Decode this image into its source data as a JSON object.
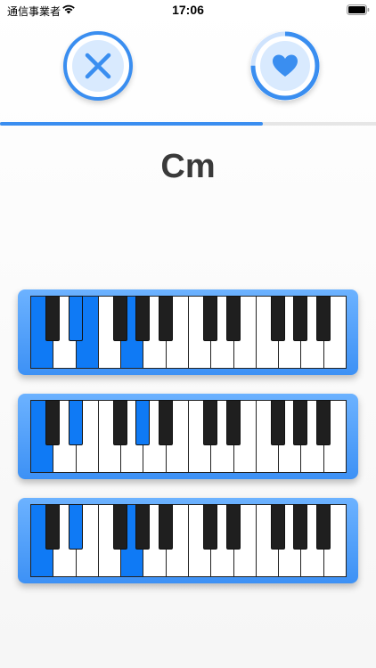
{
  "status": {
    "carrier": "通信事業者",
    "time": "17:06",
    "battery_icon": "battery-icon",
    "wifi_icon": "wifi-icon"
  },
  "controls": {
    "close_icon": "close-icon",
    "favorite_icon": "heart-icon",
    "favorite_ring_progress": 0.75
  },
  "progress": {
    "value": 0.7
  },
  "chord": {
    "name": "Cm"
  },
  "colors": {
    "accent": "#3a8ef0",
    "highlight": "#0f7af5",
    "frame": "#4a9bf7"
  },
  "keyboards": [
    {
      "highlighted_keys": [
        "w0",
        "w2",
        "w4",
        "b1"
      ]
    },
    {
      "highlighted_keys": [
        "w0",
        "b1",
        "b3"
      ]
    },
    {
      "highlighted_keys": [
        "w0",
        "w4",
        "b1"
      ]
    }
  ]
}
